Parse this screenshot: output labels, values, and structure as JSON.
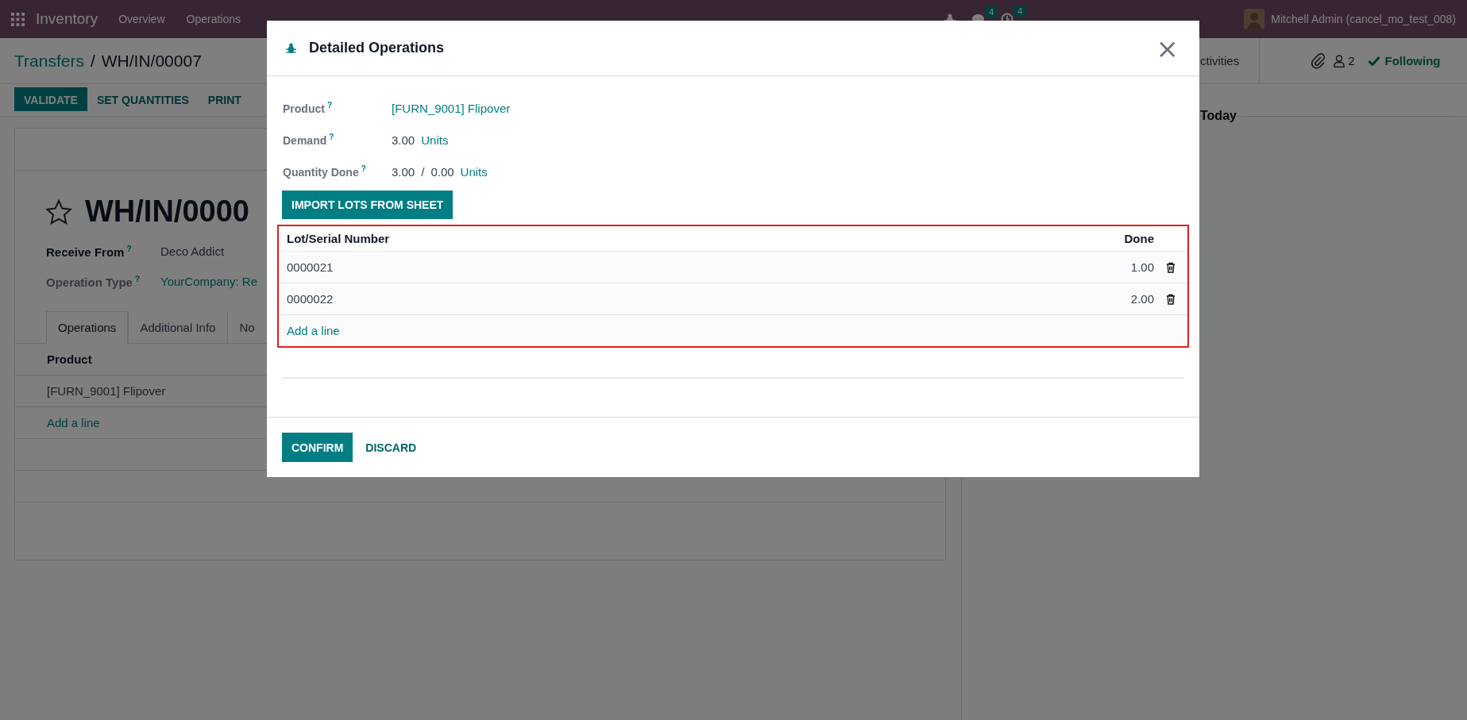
{
  "topbar": {
    "app": "Inventory",
    "menu": [
      "Overview",
      "Operations"
    ],
    "chat_count": "4",
    "activity_count": "4",
    "user": "Mitchell Admin (cancel_mo_test_008)"
  },
  "breadcrumb": {
    "parent": "Transfers",
    "separator": "/",
    "current": "WH/IN/00007"
  },
  "actions": [
    {
      "label": "VALIDATE",
      "primary": true
    },
    {
      "label": "SET QUANTITIES",
      "primary": false
    },
    {
      "label": "PRINT",
      "primary": false
    }
  ],
  "chatter": {
    "tab": "ctivities",
    "followers": "2",
    "follow": "Following",
    "day": "Today"
  },
  "record": {
    "title": "WH/IN/0000",
    "starred": false,
    "fields": [
      {
        "label": "Receive From",
        "help": "?",
        "value": "Deco Addict",
        "kind": "text",
        "required": true
      },
      {
        "label": "Operation Type",
        "help": "?",
        "value": "YourCompany: Re",
        "kind": "link",
        "required": false
      }
    ],
    "tabs": [
      {
        "label": "Operations",
        "selected": true
      },
      {
        "label": "Additional Info",
        "selected": false
      },
      {
        "label": "No",
        "selected": false
      }
    ],
    "table": {
      "columns": [
        "Product"
      ],
      "rows": [
        "[FURN_9001] Flipover"
      ],
      "add": "Add a line"
    }
  },
  "dialog": {
    "title": "Detailed Operations",
    "close": "×",
    "fields": [
      {
        "label": "Product",
        "help": "?",
        "parts": [
          {
            "text": "[FURN_9001] Flipover",
            "kind": "link"
          }
        ]
      },
      {
        "label": "Demand",
        "help": "?",
        "parts": [
          {
            "text": "3.00",
            "kind": "text"
          },
          {
            "text": "Units",
            "kind": "link"
          }
        ]
      },
      {
        "label": "Quantity Done",
        "help": "?",
        "parts": [
          {
            "text": "3.00",
            "kind": "text"
          },
          {
            "text": "/",
            "kind": "text"
          },
          {
            "text": "0.00",
            "kind": "text"
          },
          {
            "text": "Units",
            "kind": "link"
          }
        ]
      }
    ],
    "import_button": "IMPORT LOTS FROM SHEET",
    "table": {
      "columns": [
        "Lot/Serial Number",
        "Done"
      ],
      "rows": [
        {
          "lot": "0000021",
          "done": "1.00"
        },
        {
          "lot": "0000022",
          "done": "2.00"
        }
      ],
      "add": "Add a line"
    },
    "buttons": [
      {
        "label": "CONFIRM",
        "primary": true
      },
      {
        "label": "DISCARD",
        "primary": false
      }
    ]
  }
}
